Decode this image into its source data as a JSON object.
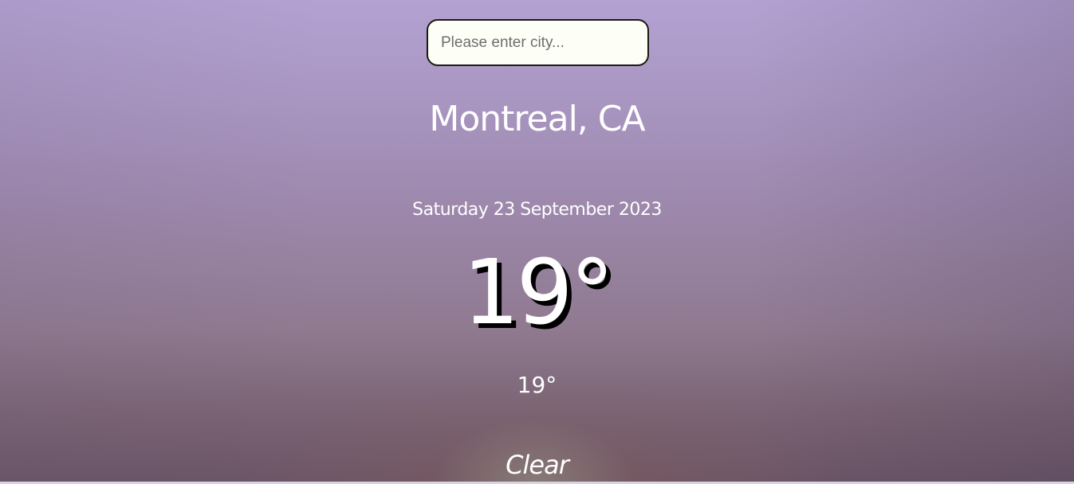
{
  "search": {
    "placeholder": "Please enter city...",
    "value": ""
  },
  "location": {
    "city": "Montreal, CA"
  },
  "date": {
    "text": "Saturday 23 September 2023"
  },
  "weather": {
    "temperature": "19°",
    "secondary_temperature": "19°",
    "condition": "Clear"
  },
  "colors": {
    "background_top": "#b3a1d2",
    "background_bottom": "#6a5567",
    "text": "#ffffff",
    "input_background": "#fdfff6",
    "input_border": "#1a1a12"
  }
}
